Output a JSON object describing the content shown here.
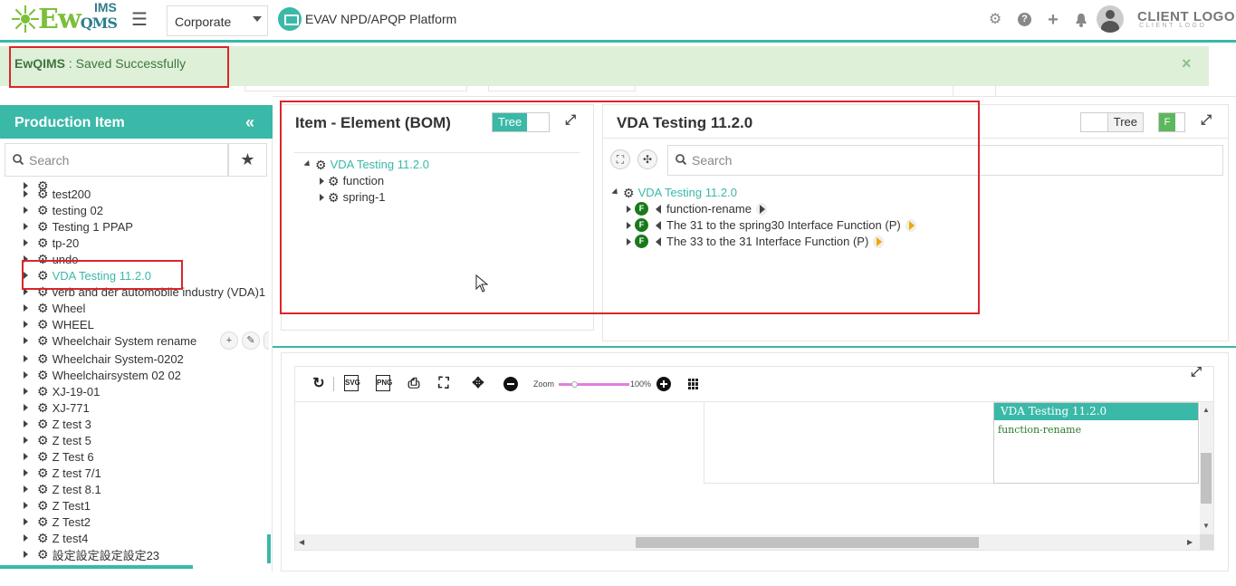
{
  "header": {
    "logo_ew": "Ew",
    "logo_qms": "QMS",
    "logo_ims": "IMS",
    "org_select_value": "Corporate",
    "app_title": "EVAV NPD/APQP Platform",
    "client_logo": "CLIENT LOGO",
    "client_logo_sub": "CLIENT LOGO",
    "icons": [
      "gear-icon",
      "help-icon",
      "plus-icon",
      "bell-icon",
      "avatar"
    ]
  },
  "alert": {
    "brand": "EwQIMS",
    "message": " : Saved Successfully",
    "close": "×"
  },
  "sidebar": {
    "title": "Production Item",
    "collapse": "«",
    "search_placeholder": "Search",
    "items": [
      "test200",
      "testing 02",
      "Testing 1 PPAP",
      "tp-20",
      "undo",
      "VDA Testing 11.2.0",
      "verb and der automobile industry (VDA)1",
      "Wheel",
      "WHEEL",
      "Wheelchair System rename",
      "Wheelchair System-0202",
      "Wheelchairsystem 02 02",
      "XJ-19-01",
      "XJ-771",
      "Z test 3",
      "Z test 5",
      "Z Test 6",
      "Z test 7/1",
      "Z test 8.1",
      "Z Test1",
      "Z Test2",
      "Z test4",
      "設定設定設定設定23"
    ],
    "selected": "VDA Testing 11.2.0"
  },
  "bom_panel": {
    "title": "Item - Element (BOM)",
    "toggle_label": "Tree",
    "root": "VDA Testing 11.2.0",
    "children": [
      "function",
      "spring-1"
    ]
  },
  "vda_panel": {
    "title": "VDA Testing 11.2.0",
    "toggle_label": "Tree",
    "f_label": "F",
    "search_placeholder": "Search",
    "root": "VDA Testing 11.2.0",
    "functions": [
      "function-rename",
      "The 31 to the spring30 Interface Function (P)",
      "The 33 to the 31 Interface Function (P)"
    ],
    "badge": "F"
  },
  "graph_panel": {
    "zoom_label": "Zoom",
    "zoom_value": "100%",
    "card_title": "VDA Testing 11.2.0",
    "card_item": "function-rename"
  }
}
